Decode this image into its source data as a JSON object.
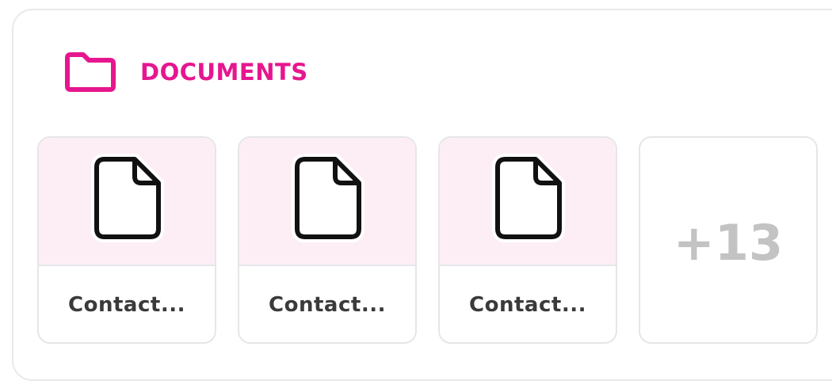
{
  "section": {
    "title": "DOCUMENTS",
    "icon": "folder-icon",
    "accent_color": "#e6168f"
  },
  "documents": [
    {
      "name": "Contact...",
      "icon": "file-icon"
    },
    {
      "name": "Contact...",
      "icon": "file-icon"
    },
    {
      "name": "Contact...",
      "icon": "file-icon"
    }
  ],
  "more": {
    "count_label": "+13"
  },
  "colors": {
    "thumb_background": "#fdeef6",
    "border": "#e6e6ea",
    "more_text": "#c3c3c3"
  }
}
